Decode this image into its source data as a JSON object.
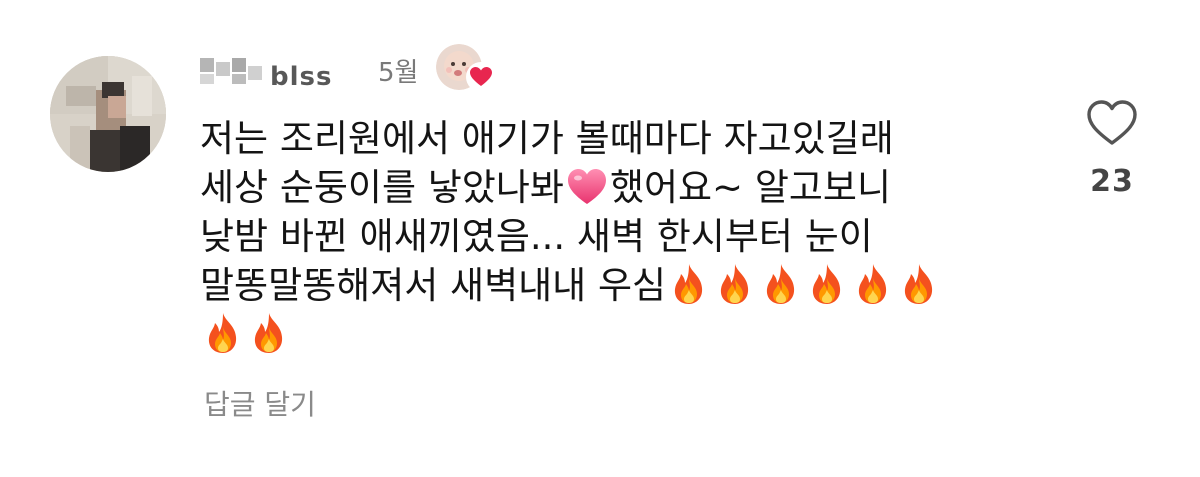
{
  "comment": {
    "username": "blss",
    "time": "5월",
    "author_liked": true,
    "text_lines": [
      "저는 조리원에서 애기가 볼때마다 자고있길래",
      "세상 순둥이를 낳았나봐",
      "했어요~ 알고보니",
      "낮밤 바뀐 애새끼였음... 새벽 한시부터 눈이",
      "말똥말똥해져서 새벽내내 우심"
    ],
    "reply_label": "답글 달기",
    "like_count": "23"
  },
  "icons": {
    "like": "heart-outline-icon",
    "inline_heart": "pink-heart-emoji",
    "fire": "fire-emoji",
    "author_like_badge": "red-heart-icon"
  },
  "colors": {
    "text": "#141414",
    "secondary": "#8a8a8a",
    "heart": "#e8264f",
    "pink_heart": "#f25a8c"
  }
}
